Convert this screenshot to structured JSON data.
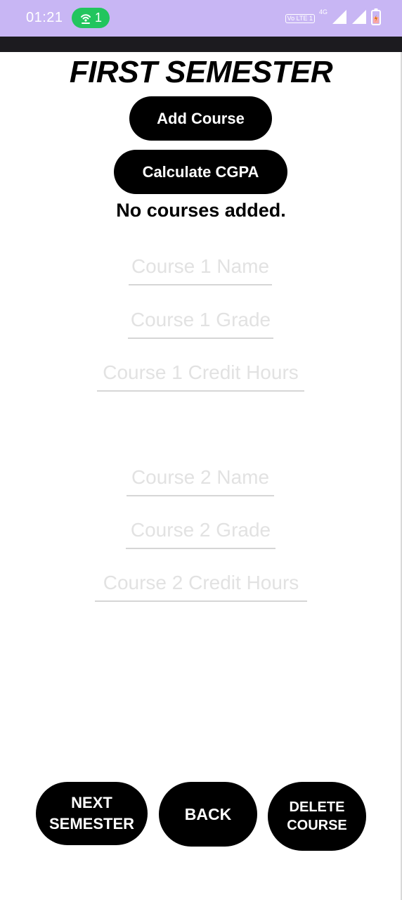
{
  "status_bar": {
    "time": "01:21",
    "hotspot_count": "1",
    "volte_label": "Vo LTE 1",
    "network_type": "4G",
    "icons": [
      "hotspot-icon",
      "volte-icon",
      "signal-icon",
      "signal-icon",
      "battery-icon"
    ]
  },
  "header": {
    "title": "FIRST SEMESTER"
  },
  "actions": {
    "add_course_label": "Add Course",
    "calculate_cgpa_label": "Calculate CGPA"
  },
  "status_message": "No courses added.",
  "courses": [
    {
      "name_placeholder": "Course 1 Name",
      "grade_placeholder": "Course 1 Grade",
      "credit_placeholder": "Course 1 Credit Hours"
    },
    {
      "name_placeholder": "Course 2 Name",
      "grade_placeholder": "Course 2 Grade",
      "credit_placeholder": "Course 2 Credit Hours"
    }
  ],
  "footer": {
    "next_semester_line1": "NEXT",
    "next_semester_line2": "SEMESTER",
    "back_label": "BACK",
    "delete_course_line1": "DELETE",
    "delete_course_line2": "COURSE"
  },
  "colors": {
    "status_bar_bg": "#c8b6f4",
    "hotspot_pill": "#22c55e",
    "button_bg": "#000000",
    "button_text": "#ffffff",
    "placeholder": "#e2e2e2"
  }
}
